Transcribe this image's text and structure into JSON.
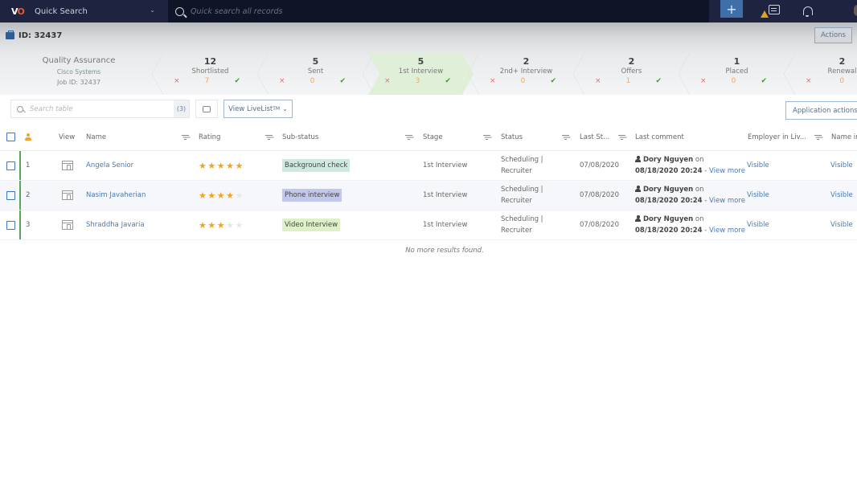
{
  "topbar": {
    "logo": "VO",
    "quick_search_label": "Quick Search",
    "search_placeholder": "Quick search all records",
    "add_button": "+"
  },
  "record": {
    "id_label": "ID: 32437",
    "actions_label": "Actions"
  },
  "job": {
    "title": "Quality Assurance",
    "company": "Cisco Systems",
    "job_id": "Job ID: 32437"
  },
  "pipeline": [
    {
      "count": "12",
      "label": "Shortlisted",
      "rejected": "×",
      "pending": "7",
      "accepted": "✔",
      "active": false
    },
    {
      "count": "5",
      "label": "Sent",
      "rejected": "×",
      "pending": "0",
      "accepted": "✔",
      "active": false
    },
    {
      "count": "5",
      "label": "1st Interview",
      "rejected": "×",
      "pending": "3",
      "accepted": "✔",
      "active": true
    },
    {
      "count": "2",
      "label": "2nd+ Interview",
      "rejected": "×",
      "pending": "0",
      "accepted": "✔",
      "active": false
    },
    {
      "count": "2",
      "label": "Offers",
      "rejected": "×",
      "pending": "1",
      "accepted": "✔",
      "active": false
    },
    {
      "count": "1",
      "label": "Placed",
      "rejected": "×",
      "pending": "0",
      "accepted": "✔",
      "active": false
    },
    {
      "count": "2",
      "label": "Renewal",
      "rejected": "×",
      "pending": "0",
      "accepted": "",
      "active": false
    }
  ],
  "toolbar": {
    "search_placeholder": "Search table",
    "result_count": "(3)",
    "livelist_label": "View LiveList",
    "livelist_sup": "TM",
    "livelist_chevron": "⌄",
    "application_actions": "Application actions"
  },
  "table": {
    "columns": {
      "view": "View",
      "name": "Name",
      "rating": "Rating",
      "substatus": "Sub-status",
      "stage": "Stage",
      "status": "Status",
      "last_status": "Last St...",
      "last_comment": "Last comment",
      "employer_livelist": "Employer in Liv...",
      "name_in": "Name in"
    },
    "rows": [
      {
        "num": "1",
        "name": "Angela Senior",
        "rating": 5,
        "substatus": "Background check",
        "substatus_color": "#cfe8e2",
        "stage": "1st Interview",
        "status_line1": "Scheduling |",
        "status_line2": "Recruiter",
        "last_status": "07/08/2020",
        "commenter": "Dory Nguyen",
        "comment_on": "on",
        "comment_date": "08/18/2020 20:24",
        "comment_sep": " - ",
        "view_more": "View more",
        "employer": "Visible",
        "name_in": "Visible"
      },
      {
        "num": "2",
        "name": "Nasim Javaherian",
        "rating": 4,
        "substatus": "Phone interview",
        "substatus_color": "#c3c7ec",
        "stage": "1st Interview",
        "status_line1": "Scheduling |",
        "status_line2": "Recruiter",
        "last_status": "07/08/2020",
        "commenter": "Dory Nguyen",
        "comment_on": "on",
        "comment_date": "08/18/2020 20:24",
        "comment_sep": " - ",
        "view_more": "View more",
        "employer": "Visible",
        "name_in": "Visible"
      },
      {
        "num": "3",
        "name": "Shraddha Javaria",
        "rating": 3,
        "substatus": "Video Interview",
        "substatus_color": "#def0c8",
        "stage": "1st Interview",
        "status_line1": "Scheduling |",
        "status_line2": "Recruiter",
        "last_status": "07/08/2020",
        "commenter": "Dory Nguyen",
        "comment_on": "on",
        "comment_date": "08/18/2020 20:24",
        "comment_sep": " - ",
        "view_more": "View more",
        "employer": "Visible",
        "name_in": "Visible"
      }
    ],
    "empty_message": "No more results found."
  }
}
